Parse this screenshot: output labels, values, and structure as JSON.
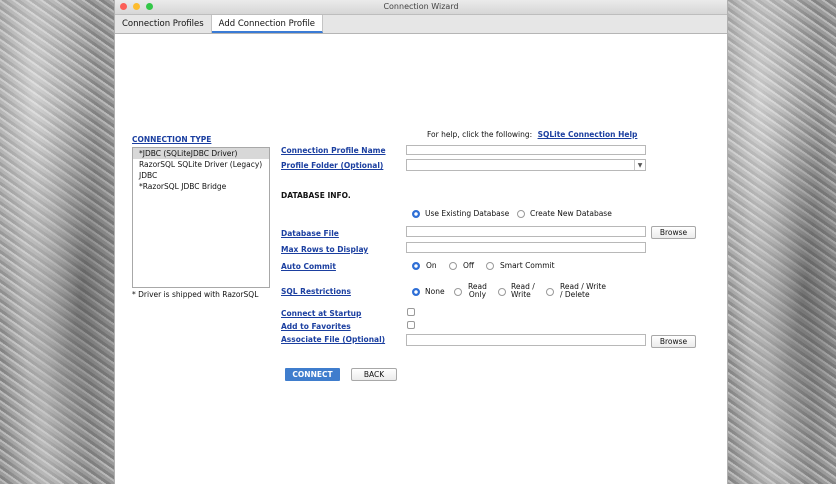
{
  "window": {
    "title": "Connection Wizard"
  },
  "traffic_colors": {
    "close": "#fc5f57",
    "minimize": "#fdbc2e",
    "zoom": "#33c748"
  },
  "tabs": [
    {
      "label": "Connection Profiles",
      "selected": false
    },
    {
      "label": "Add Connection Profile",
      "selected": true
    }
  ],
  "connection_type": {
    "heading": "CONNECTION TYPE",
    "items": [
      "*JDBC (SQLiteJDBC Driver)",
      "RazorSQL SQLite Driver (Legacy)",
      "JDBC",
      "*RazorSQL JDBC Bridge"
    ],
    "selected_index": 0,
    "note": "* Driver is shipped with RazorSQL"
  },
  "help": {
    "text": "For help, click the following:",
    "link": "SQLite Connection Help"
  },
  "form": {
    "profile_name_label": "Connection Profile Name",
    "profile_name_value": "",
    "profile_folder_label": "Profile Folder (Optional)",
    "profile_folder_value": "",
    "db_info_heading": "DATABASE INFO.",
    "db_mode_options": [
      "Use Existing Database",
      "Create New Database"
    ],
    "db_mode_selected": "Use Existing Database",
    "database_file_label": "Database File",
    "database_file_value": "",
    "browse_label": "Browse",
    "max_rows_label": "Max Rows to Display",
    "max_rows_value": "",
    "auto_commit_label": "Auto Commit",
    "auto_commit_options": [
      "On",
      "Off",
      "Smart Commit"
    ],
    "auto_commit_selected": "On",
    "sql_restrictions_label": "SQL Restrictions",
    "sql_restrictions_options": [
      "None",
      "Read Only",
      "Read / Write",
      "Read / Write / Delete"
    ],
    "sql_restrictions_selected": "None",
    "connect_at_startup_label": "Connect at Startup",
    "connect_at_startup_checked": false,
    "add_to_favorites_label": "Add to Favorites",
    "add_to_favorites_checked": false,
    "associate_file_label": "Associate File (Optional)",
    "associate_file_value": "",
    "browse2_label": "Browse"
  },
  "actions": {
    "connect_label": "CONNECT",
    "back_label": "BACK"
  },
  "wrapped": {
    "read": "Read",
    "only": "Only",
    "read2": "Read /",
    "write": "Write",
    "read3": "Read / Write",
    "delete": "/ Delete"
  }
}
